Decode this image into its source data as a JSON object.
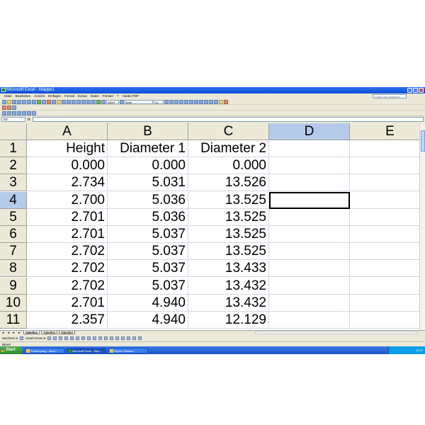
{
  "window": {
    "title": "Microsoft Excel - Mappe1"
  },
  "menu": {
    "items": [
      "Datei",
      "Bearbeiten",
      "Ansicht",
      "Einfügen",
      "Format",
      "Extras",
      "Daten",
      "Fenster",
      "?",
      "Adobe PDF"
    ],
    "help_placeholder": "Frage hier eingeben"
  },
  "toolbar": {
    "font_name": "Arial",
    "font_size": "10",
    "zoom": "400%"
  },
  "formula_bar": {
    "cell_reference": "D4",
    "fx_label": "fx",
    "content": ""
  },
  "grid": {
    "columns": [
      "A",
      "B",
      "C",
      "D",
      "E"
    ],
    "selected_column": "D",
    "selected_row": "4",
    "active_cell": "D4",
    "rows": [
      {
        "num": "1",
        "cells": [
          "Height",
          "Diameter 1",
          "Diameter 2",
          "",
          ""
        ]
      },
      {
        "num": "2",
        "cells": [
          "0.000",
          "0.000",
          "0.000",
          "",
          ""
        ]
      },
      {
        "num": "3",
        "cells": [
          "2.734",
          "5.031",
          "13.526",
          "",
          ""
        ]
      },
      {
        "num": "4",
        "cells": [
          "2.700",
          "5.036",
          "13.525",
          "",
          ""
        ]
      },
      {
        "num": "5",
        "cells": [
          "2.701",
          "5.036",
          "13.525",
          "",
          ""
        ]
      },
      {
        "num": "6",
        "cells": [
          "2.701",
          "5.037",
          "13.525",
          "",
          ""
        ]
      },
      {
        "num": "7",
        "cells": [
          "2.702",
          "5.037",
          "13.525",
          "",
          ""
        ]
      },
      {
        "num": "8",
        "cells": [
          "2.702",
          "5.037",
          "13.433",
          "",
          ""
        ]
      },
      {
        "num": "9",
        "cells": [
          "2.702",
          "5.037",
          "13.432",
          "",
          ""
        ]
      },
      {
        "num": "10",
        "cells": [
          "2.701",
          "4.940",
          "13.432",
          "",
          ""
        ]
      },
      {
        "num": "11",
        "cells": [
          "2.357",
          "4.940",
          "12.129",
          "",
          ""
        ]
      }
    ]
  },
  "sheets": {
    "nav": "◄ ◄ ► ►",
    "tabs": [
      "Tabelle1",
      "Tabelle2",
      "Tabelle3"
    ],
    "active": "Tabelle1"
  },
  "draw_toolbar": {
    "draw_label": "Zeichnen ▾",
    "autoshapes_label": "AutoFormen ▾"
  },
  "status": {
    "text": "Bereit"
  },
  "taskbar": {
    "start_label": "Start",
    "tasks": [
      "Posteingang - Micro...",
      "Microsoft Excel - Map...",
      "Eigene Dateien"
    ],
    "active_task_index": 1,
    "clock": "14:27"
  },
  "colors": {
    "selected_header": "#b6cbe9",
    "title_bar": "#0a4fd6",
    "grid_line": "#d0d7e5"
  }
}
